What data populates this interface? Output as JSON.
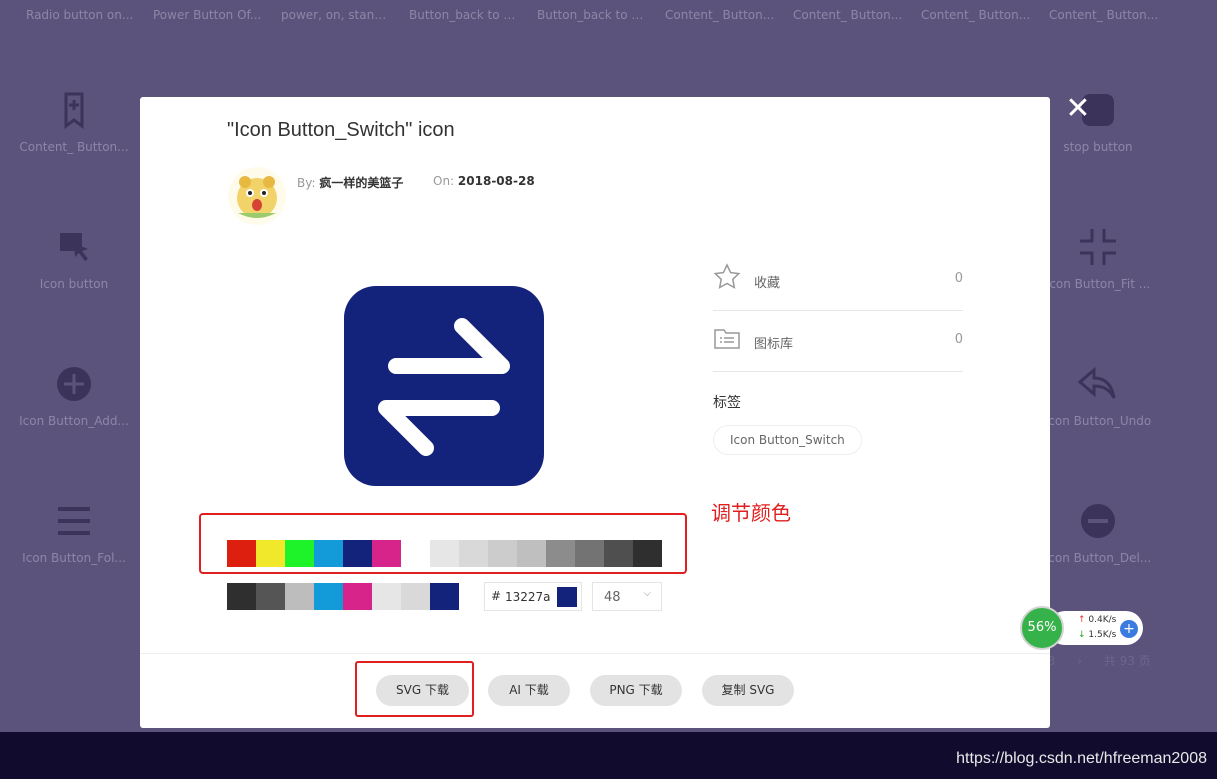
{
  "background": {
    "top_labels": [
      "Radio button on...",
      "Power Button Of...",
      "power, on, stand...",
      "Button_back to t...",
      "Button_back to t...",
      "Content_ Button...",
      "Content_ Button...",
      "Content_ Button...",
      "Content_ Button..."
    ],
    "left_items": [
      {
        "label": "Content_ Button...",
        "icon": "bookmark-add-icon"
      },
      {
        "label": "Icon button",
        "icon": "square-cursor-icon"
      },
      {
        "label": "Icon Button_Add...",
        "icon": "plus-circle-icon"
      },
      {
        "label": "Icon Button_Fol...",
        "icon": "menu-icon"
      }
    ],
    "right_items": [
      {
        "label": "stop button",
        "icon": "stop-icon"
      },
      {
        "label": "Icon Button_Fit ...",
        "icon": "fit-icon"
      },
      {
        "label": "Icon Button_Undo",
        "icon": "undo-icon"
      },
      {
        "label": "Icon Button_Del...",
        "icon": "minus-circle-icon"
      }
    ],
    "pager": {
      "current": "93",
      "total": "共 93 页"
    },
    "watermark": "https://blog.csdn.net/hfreeman2008"
  },
  "modal": {
    "title": "\"Icon Button_Switch\" icon",
    "by_label": "By:",
    "author": "疯一样的美篮子",
    "on_label": "On:",
    "date": "2018-08-28",
    "icon_color": "#13227a",
    "stats": [
      {
        "label": "收藏",
        "count": "0",
        "icon": "star-icon"
      },
      {
        "label": "图标库",
        "count": "0",
        "icon": "folder-list-icon"
      }
    ],
    "tags_heading": "标签",
    "tag": "Icon Button_Switch",
    "annotation": "调节颜色",
    "palette_primary": [
      "#dc1f0e",
      "#f1e82c",
      "#1ef32a",
      "#129ad9",
      "#13227a",
      "#d6248a",
      "#ffffff",
      "#e6e6e6",
      "#d9d9d9",
      "#cccccc",
      "#bfbfbf",
      "#8c8c8c",
      "#737373",
      "#4f4f4f",
      "#2f2f2f"
    ],
    "palette_recent": [
      "#2f2f2f",
      "#555555",
      "#bdbdbd",
      "#129ad9",
      "#d6248a",
      "#e6e6e6",
      "#d9d9d9",
      "#13227a"
    ],
    "hex_symbol": "#",
    "hex_value": "13227a",
    "size_value": "48",
    "buttons": [
      "SVG 下载",
      "AI 下载",
      "PNG 下载",
      "复制 SVG"
    ]
  },
  "speed_widget": {
    "percent": "56%",
    "up": "0.4K/s",
    "down": "1.5K/s"
  }
}
